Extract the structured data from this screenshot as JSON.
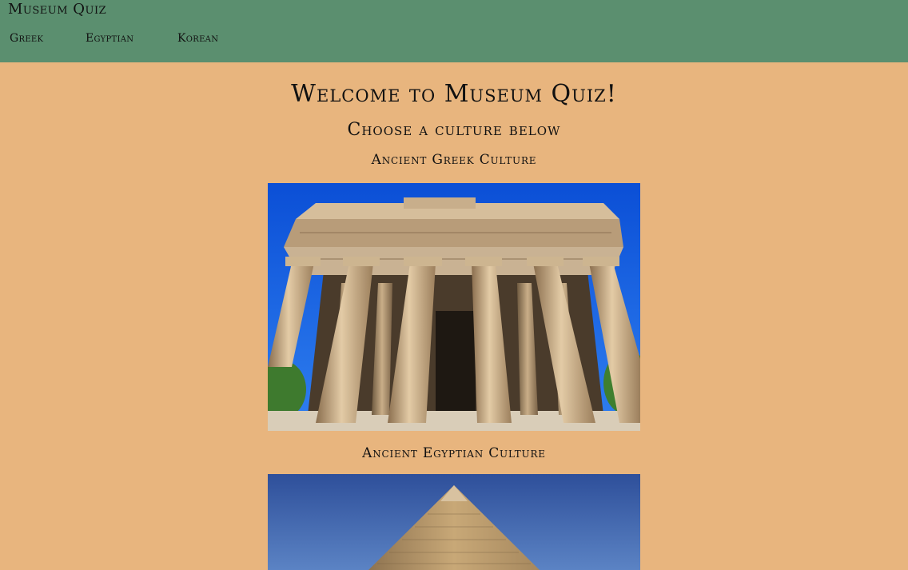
{
  "header": {
    "site_title": "Museum Quiz",
    "nav": [
      "Greek",
      "Egyptian",
      "Korean"
    ]
  },
  "main": {
    "welcome": "Welcome to Museum Quiz!",
    "subtitle": "Choose a culture below",
    "sections": [
      {
        "heading": "Ancient Greek Culture"
      },
      {
        "heading": "Ancient Egyptian Culture"
      }
    ]
  },
  "colors": {
    "header_bg": "#5B8F6F",
    "page_bg": "#E8B57E"
  }
}
